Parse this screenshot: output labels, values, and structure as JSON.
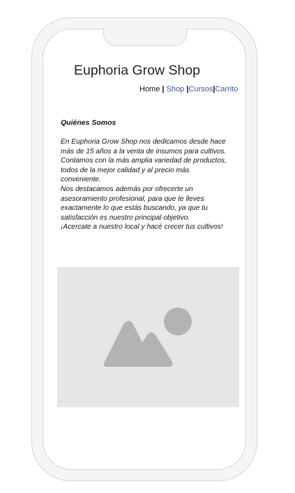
{
  "site": {
    "title": "Euphoria Grow Shop"
  },
  "nav": {
    "home": "Home",
    "separator": "|",
    "shop": "Shop",
    "cursos": "Cursos",
    "carrito": "Carrito"
  },
  "about": {
    "heading": "Quiénes Somos",
    "paragraphs": [
      "En Euphoria Grow Shop nos dedicamos desde hace más de 15 años a la venta de insumos para cultivos.",
      "Contamos con la más amplia variedad de productos, todos de la mejor calidad y al precio más conveniente.",
      "Nos destacamos además por ofrecerte un asesoramiento profesional, para que te lleves exactamente lo que estás buscando, ya que tu satisfacción es nuestro principal objetivo.",
      "¡Acercate a nuestro local y hacé crecer tus cultivos!"
    ]
  },
  "image": {
    "icon": "image-placeholder-icon",
    "background_color": "#e6e6e6",
    "icon_color": "#b3b3b3"
  },
  "colors": {
    "link": "#2f58a8",
    "frame_border": "#d6d3d5",
    "frame_fill": "#f6f5f6"
  }
}
